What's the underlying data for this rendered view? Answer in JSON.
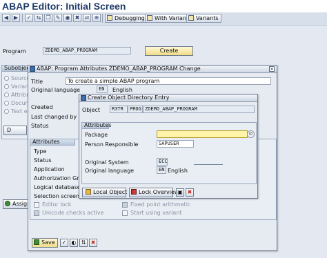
{
  "title": "ABAP Editor: Initial Screen",
  "toolbar": {
    "debugging": "Debugging",
    "with_variant": "With Variant",
    "variants": "Variants"
  },
  "main": {
    "program_label": "Program",
    "program_value": "ZDEMO_ABAP_PROGRAM",
    "create_button": "Create",
    "subobject_tab": "Subobject",
    "radios": [
      "Source",
      "Variants",
      "Attributes",
      "Documentation",
      "Text elements"
    ],
    "display_button": "D",
    "assign_button": "Assign"
  },
  "attr_dialog": {
    "title": "ABAP: Program Attributes ZDEMO_ABAP_PROGRAM Change",
    "title_label": "Title",
    "title_value": "To create a simple ABAP program",
    "orig_lang_label": "Original language",
    "orig_lang_code": "EN",
    "orig_lang_name": "English",
    "created_label": "Created",
    "last_changed_label": "Last changed by",
    "status_label": "Status",
    "attributes_header": "Attributes",
    "attr_labels": [
      "Type",
      "Status",
      "Application",
      "Authorization Group",
      "Logical database",
      "Selection screen"
    ],
    "checkboxes": {
      "editor_lock": "Editor lock",
      "unicode": "Unicode checks active",
      "fixed_point": "Fixed point arithmetic",
      "start_variant": "Start using variant"
    },
    "save_button": "Save"
  },
  "obj_dialog": {
    "title": "Create Object Directory Entry",
    "object_label": "Object",
    "object_r3tr": "R3TR",
    "object_prog": "PROG",
    "object_name": "ZDEMO_ABAP_PROGRAM",
    "attributes_header": "Attributes",
    "package_label": "Package",
    "package_value": "",
    "person_label": "Person Responsible",
    "person_value": "SAPUSER",
    "orig_system_label": "Original System",
    "orig_system_value": "ECC",
    "orig_lang_label": "Original language",
    "orig_lang_code": "EN",
    "orig_lang_name": "English",
    "local_object_button": "Local Object",
    "lock_overview_button": "Lock Overview"
  },
  "colors": {
    "title": "#1f3b68",
    "required_field": "#fff4a8",
    "button": "#f0dc86"
  },
  "icons": [
    "check-icon",
    "save-icon",
    "back-icon",
    "exit-icon",
    "cancel-icon",
    "print-icon",
    "find-icon",
    "debug-icon",
    "variant-icon",
    "help-icon",
    "local-object-icon",
    "lock-icon",
    "close-icon"
  ]
}
